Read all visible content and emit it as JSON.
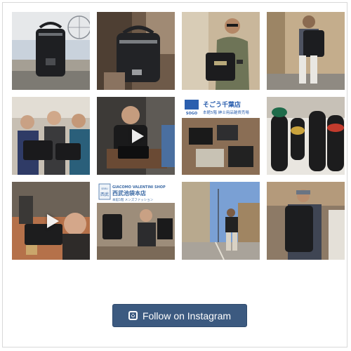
{
  "feed": {
    "tiles": [
      {
        "alt": "Black backpack on wall with ferris wheel",
        "has_video": false
      },
      {
        "alt": "Black leather backpack held up",
        "has_video": false
      },
      {
        "alt": "Man in sunglasses holding black bag",
        "has_video": false
      },
      {
        "alt": "Man wearing black backpack on street",
        "has_video": false
      },
      {
        "alt": "Group of men holding bags",
        "has_video": false
      },
      {
        "alt": "Craftsman working on leather bag",
        "has_video": true
      },
      {
        "alt": "Store display with brochures",
        "has_video": false
      },
      {
        "alt": "Bag display mannequins",
        "has_video": false
      },
      {
        "alt": "Leather workshop close-up",
        "has_video": true
      },
      {
        "alt": "Shop interior with bags",
        "has_video": false
      },
      {
        "alt": "Man walking with sling bag",
        "has_video": false
      },
      {
        "alt": "Man wearing backpack in shop",
        "has_video": false
      }
    ],
    "sign_sogo": {
      "name": "そごう千葉店",
      "subtitle": "本館5階 紳士用品雑貨売場",
      "logo": "SOGO"
    },
    "sign_seibu": {
      "title": "GIACOMO VALENTINI SHOP",
      "store": "西武池袋本店",
      "subtitle": "本館5階 メンズファッション",
      "logo_line1": "SEIBU",
      "logo_line2": "西武"
    }
  },
  "follow_button": {
    "label": "Follow on Instagram",
    "icon": "instagram-icon",
    "color": "#3c5a80"
  }
}
